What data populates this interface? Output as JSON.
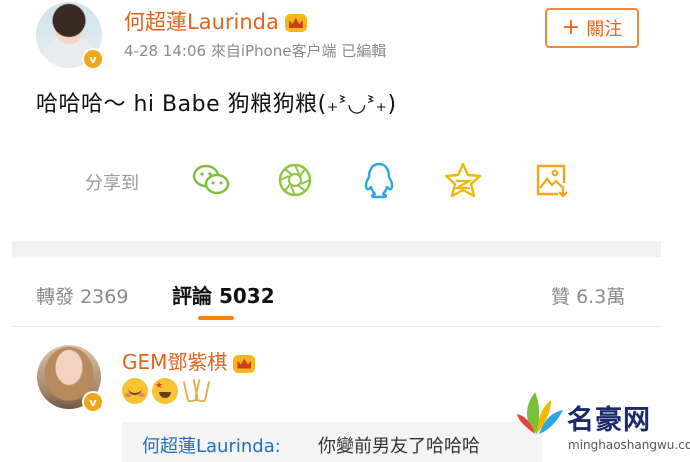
{
  "post": {
    "author": "何超蓮Laurinda",
    "verified_badge": "v",
    "time": "4-28 14:06",
    "source": "來自iPhone客户端",
    "edited": "已編輯",
    "follow_label": "關注",
    "follow_plus": "+",
    "text": "哈哈哈～ hi Babe 狗粮狗粮(₊ᕑ◡ᕑ₊)"
  },
  "share": {
    "label": "分享到",
    "targets": [
      "wechat-icon",
      "moments-icon",
      "qq-icon",
      "qzone-icon",
      "save-image-icon"
    ],
    "colors": {
      "wechat": "#7bbf3a",
      "moments": "#8cc63f",
      "qq": "#2aa7e0",
      "qzone": "#f2b705",
      "save": "#f2a516"
    }
  },
  "tabs": {
    "repost_label": "轉發",
    "repost_count": "2369",
    "comments_label": "評論",
    "comments_count": "5032",
    "likes_label": "贊",
    "likes_count": "6.3萬",
    "accent": "#ff8200"
  },
  "comment": {
    "author": "GEM鄧紫棋",
    "verified_badge": "v",
    "emojis": [
      "blush-emoji",
      "star-struck-emoji",
      "cheers-emoji"
    ],
    "reply_author": "何超蓮Laurinda:",
    "reply_text": "你變前男友了哈哈哈"
  },
  "watermark": {
    "name": "名豪网",
    "url": "minghaoshangwu.com"
  },
  "colors": {
    "username": "#e1641e",
    "link": "#1d6fbf",
    "muted": "#8a8a8a"
  }
}
